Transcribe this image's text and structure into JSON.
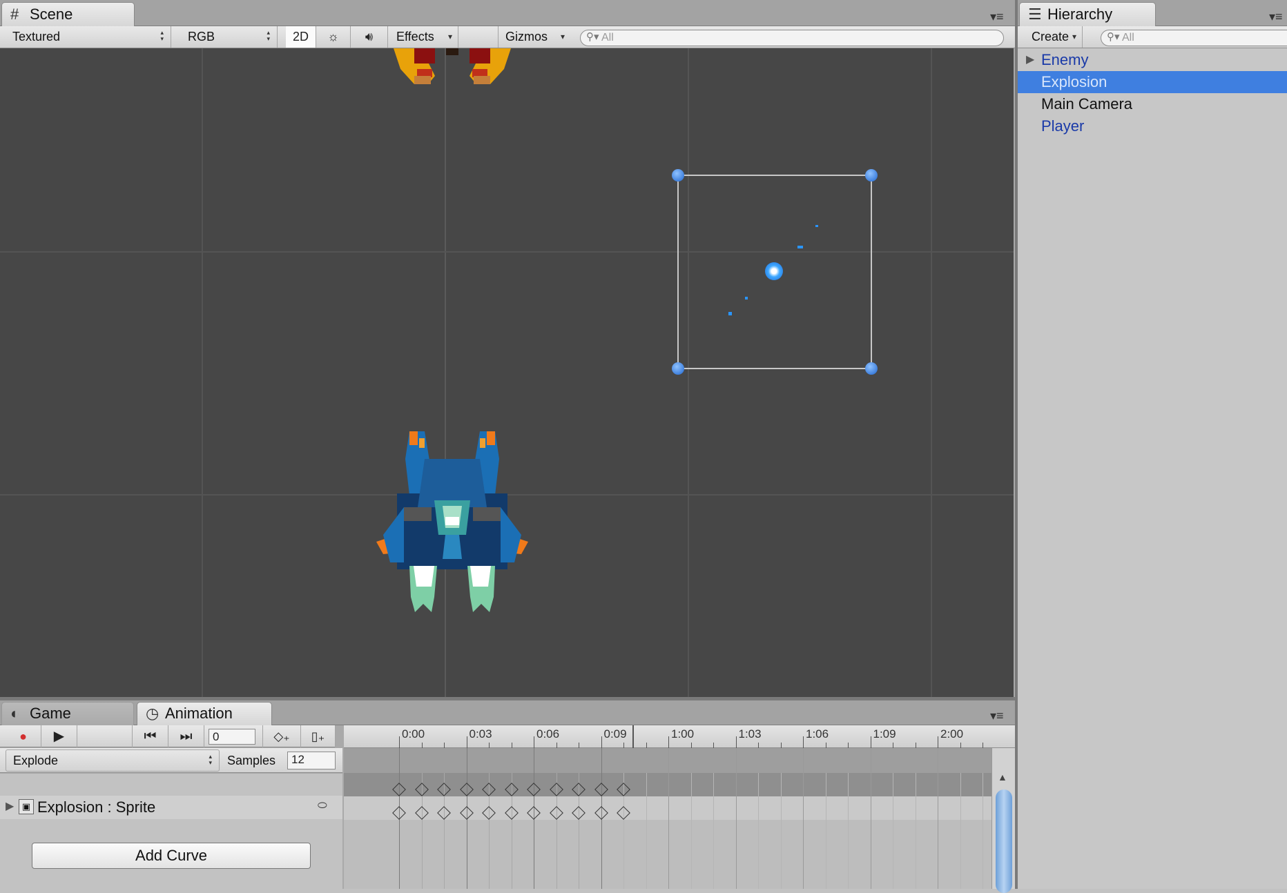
{
  "scene": {
    "tab_label": "Scene",
    "tab_icon": "grid-icon",
    "toolbar": {
      "render_mode": "Textured",
      "color_mode": "RGB",
      "mode_2d": "2D",
      "lighting_icon": "sun-icon",
      "audio_icon": "speaker-icon",
      "effects": "Effects",
      "gizmos": "Gizmos",
      "search_placeholder": "All"
    }
  },
  "hierarchy": {
    "tab_label": "Hierarchy",
    "tab_icon": "list-icon",
    "create": "Create",
    "search_placeholder": "All",
    "items": [
      {
        "label": "Enemy",
        "expandable": true,
        "selected": false,
        "color": "#1a3aa8"
      },
      {
        "label": "Explosion",
        "expandable": false,
        "selected": true,
        "color": "#d8e6fb"
      },
      {
        "label": "Main Camera",
        "expandable": false,
        "selected": false,
        "color": "#111111"
      },
      {
        "label": "Player",
        "expandable": false,
        "selected": false,
        "color": "#1a3aa8"
      }
    ]
  },
  "animation": {
    "tabs": [
      {
        "label": "Game",
        "icon": "game-icon",
        "active": false
      },
      {
        "label": "Animation",
        "icon": "clock-icon",
        "active": true
      }
    ],
    "frame_value": "0",
    "clip": "Explode",
    "samples_label": "Samples",
    "samples_value": "12",
    "property": "Explosion : Sprite",
    "add_curve": "Add Curve",
    "ruler": [
      "0:00",
      "0:03",
      "0:06",
      "0:09",
      "1:00",
      "1:03",
      "1:06",
      "1:09",
      "2:00"
    ],
    "keyframe_count": 11
  },
  "colors": {
    "selection": "#3f7fe0",
    "viewport_bg": "#474747",
    "handle": "#2f7fe8"
  }
}
